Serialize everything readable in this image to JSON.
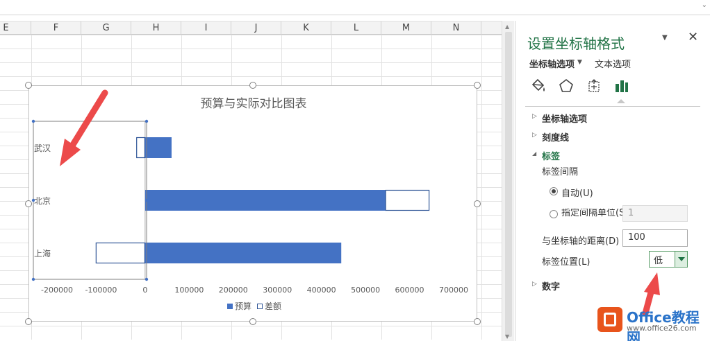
{
  "columns": [
    "E",
    "F",
    "G",
    "H",
    "I",
    "J",
    "K",
    "L",
    "M",
    "N"
  ],
  "chart_data": {
    "type": "bar",
    "orientation": "horizontal",
    "stacked": true,
    "title": "预算与实际对比图表",
    "categories": [
      "武汉",
      "北京",
      "上海"
    ],
    "series": [
      {
        "name": "预算",
        "values": [
          60000,
          545000,
          445000
        ],
        "color": "#4472C4",
        "style": "filled"
      },
      {
        "name": "差额",
        "values": [
          -20000,
          100000,
          -112000
        ],
        "color": "#2F5597",
        "style": "outline"
      }
    ],
    "xlim": [
      -200000,
      700000
    ],
    "xticks": [
      "-200000",
      "-100000",
      "0",
      "100000",
      "200000",
      "300000",
      "400000",
      "500000",
      "600000",
      "700000"
    ],
    "legend_position": "bottom",
    "vertical_axis_selected": true
  },
  "panel": {
    "title": "设置坐标轴格式",
    "tab_axis_options": "坐标轴选项",
    "tab_text_options": "文本选项",
    "icons": [
      "paint-bucket-icon",
      "pentagon-icon",
      "size-properties-icon",
      "bar-chart-icon"
    ],
    "sections": {
      "axis_options": "坐标轴选项",
      "tick_marks": "刻度线",
      "labels": "标签",
      "number": "数字"
    },
    "label_interval": "标签间隔",
    "auto": "自动(U)",
    "specify": "指定间隔单位(S)",
    "interval_value": "1",
    "distance_label": "与坐标轴的距离(D)",
    "distance_value": "100",
    "position_label": "标签位置(L)",
    "position_value": "低"
  },
  "watermark": {
    "name": "Office教程网",
    "url": "www.office26.com"
  },
  "colors": {
    "accent": "#217346",
    "budget": "#4472C4",
    "arrow": "#ec4a4a"
  }
}
